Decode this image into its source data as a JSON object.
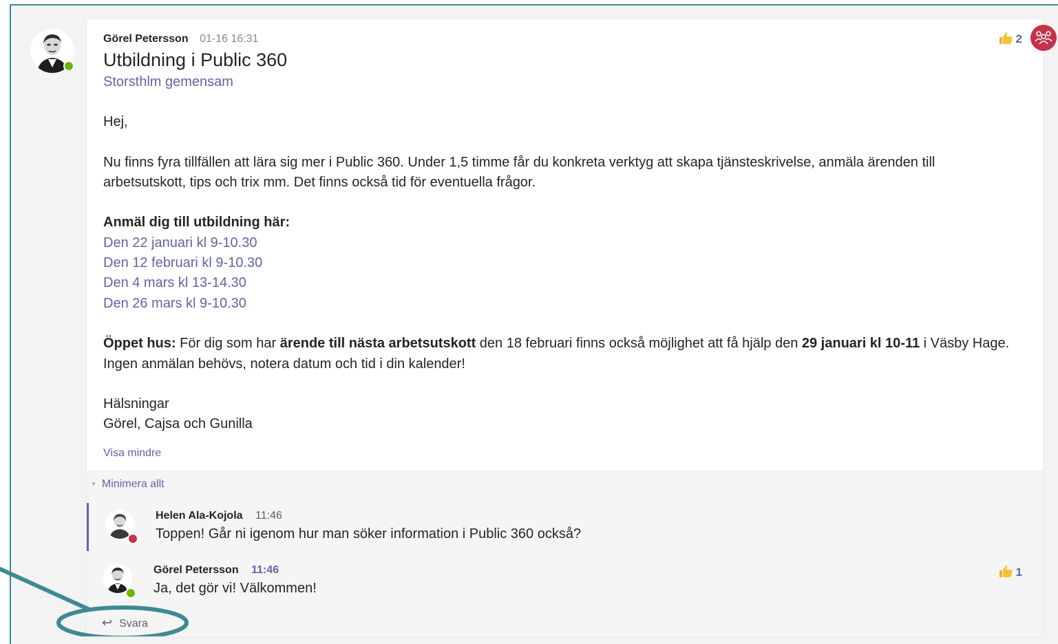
{
  "post": {
    "author": "Görel Petersson",
    "timestamp": "01-16 16:31",
    "title": "Utbildning i Public 360",
    "channel": "Storsthlm gemensam",
    "greeting": "Hej,",
    "intro": "Nu finns fyra tillfällen att lära sig mer i Public 360. Under 1,5 timme får du konkreta verktyg att skapa tjänsteskrivelse, anmäla ärenden till arbetsutskott, tips och trix mm.  Det finns också tid för eventuella frågor.",
    "signup_heading": "Anmäl dig till utbildning här:",
    "signup_links": [
      "Den 22 januari kl 9-10.30",
      "Den 12 februari kl 9-10.30",
      "Den 4 mars kl 13-14.30",
      "Den 26 mars kl 9-10.30"
    ],
    "open_house": {
      "label": "Öppet hus:",
      "part1": " För dig som har ",
      "bold1": "ärende till nästa arbetsutskott",
      "part2": " den 18 februari finns också möjlighet att få hjälp den ",
      "bold2": "29 januari kl 10-11",
      "part3": " i Väsby Hage. Ingen anmälan behövs, notera datum och tid i din kalender!"
    },
    "closing": "Hälsningar",
    "signature": "Görel, Cajsa och Gunilla",
    "show_less": "Visa mindre",
    "like_count": "2",
    "like_icon": "thumbs-up-icon"
  },
  "replies_section": {
    "collapse_all": "Minimera allt",
    "replies": [
      {
        "author": "Helen Ala-Kojola",
        "time": "11:46",
        "text": "Toppen! Går ni igenom hur man söker information i Public 360 också?",
        "presence": "busy"
      },
      {
        "author": "Görel Petersson",
        "time": "11:46",
        "text": "Ja, det gör vi! Välkommen!",
        "presence": "available",
        "like_count": "1"
      }
    ],
    "reply_button": "Svara"
  },
  "colors": {
    "accent": "#6264a7",
    "annotation": "#3d8a93",
    "available": "#6bb700",
    "busy": "#c4314b"
  }
}
